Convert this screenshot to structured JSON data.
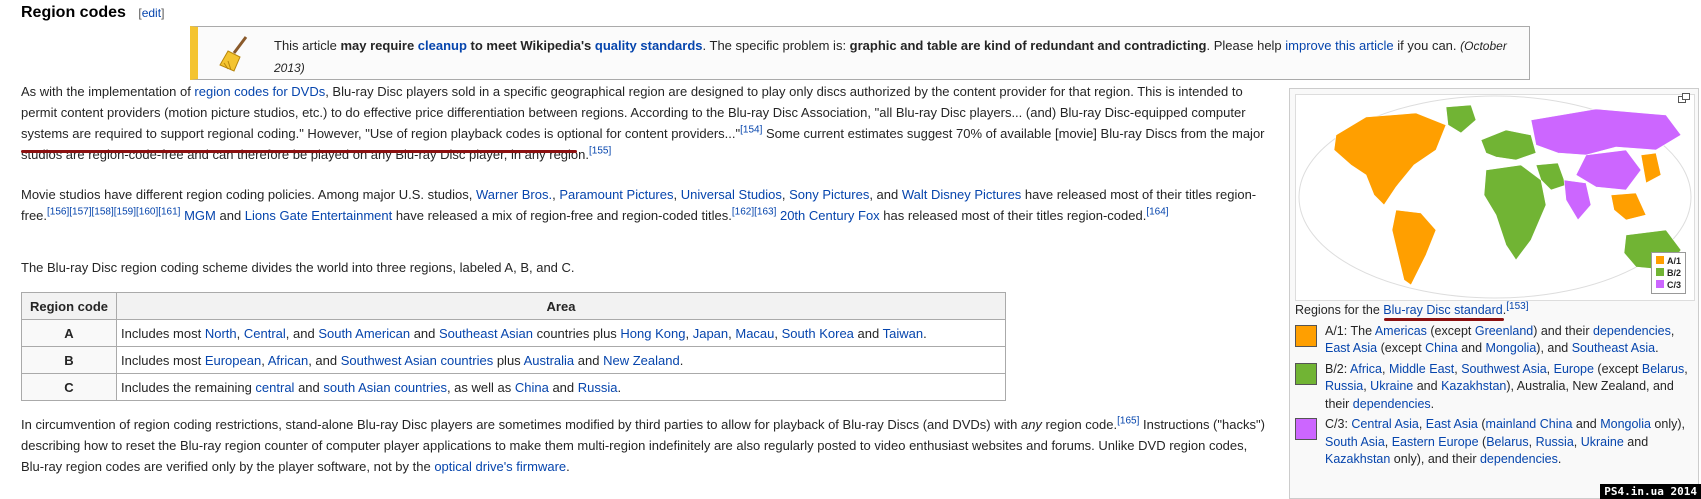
{
  "section": {
    "title": "Region codes",
    "edit_label": "edit"
  },
  "notice": {
    "t1": "This article ",
    "t2": "may require ",
    "cleanup": "cleanup",
    "t3": " to meet Wikipedia's ",
    "quality": "quality standards",
    "t4": ". The specific problem is: ",
    "problem": "graphic and table are kind of redundant and contradicting",
    "t5": ". Please help ",
    "improve": "improve this article",
    "t6": " if you can. ",
    "date": "(October 2013)"
  },
  "p1": {
    "a": "As with the implementation of ",
    "l1": "region codes for DVDs",
    "b": ", Blu-ray Disc players sold in a specific geographical region are designed to play only discs authorized by the content provider for that region. This is intended to permit content providers (motion picture studios, etc.) to do effective price differentiation between regions. According to the Blu-ray Disc Association, \"all Blu-ray Disc players... (and) Blu-ray Disc-equipped computer systems are required to support regional coding.\" However, \"Use of region playback codes is optional for content providers...\"",
    "r1": "[154]",
    "c": " Some current estimates suggest 70% of available [movie] Blu-ray Discs from the major studios are region-code-free and can therefore be played on any Blu-ray Disc player, in any region.",
    "r2": "[155]"
  },
  "p2": {
    "a": "Movie studios have different region coding policies. Among major U.S. studios, ",
    "wb": "Warner Bros.",
    "s1": ", ",
    "pp": "Paramount Pictures",
    "s2": ", ",
    "us": "Universal Studios",
    "s3": ", ",
    "sp": "Sony Pictures",
    "s4": ", and ",
    "wd": "Walt Disney Pictures",
    "b": " have released most of their titles region-free.",
    "r1": "[156][157][158][159][160][161]",
    "mgm": "MGM",
    "c": " and ",
    "lg": "Lions Gate Entertainment",
    "d": " have released a mix of region-free and region-coded titles.",
    "r2": "[162][163]",
    "fox": "20th Century Fox",
    "e": " has released most of their titles region-coded.",
    "r3": "[164]"
  },
  "p3": "The Blu-ray Disc region coding scheme divides the world into three regions, labeled A, B, and C.",
  "table": {
    "h_code": "Region code",
    "h_area": "Area",
    "A": {
      "code": "A",
      "t1": "Includes most ",
      "l1": "North",
      "s1": ", ",
      "l2": "Central",
      "s2": ", and ",
      "l3": "South American",
      "s3": " and ",
      "l4": "Southeast Asian",
      "s4": " countries plus ",
      "l5": "Hong Kong",
      "s5": ", ",
      "l6": "Japan",
      "s6": ", ",
      "l7": "Macau",
      "s7": ", ",
      "l8": "South Korea",
      "s8": " and ",
      "l9": "Taiwan",
      "s9": "."
    },
    "B": {
      "code": "B",
      "t1": "Includes most ",
      "l1": "European",
      "s1": ", ",
      "l2": "African",
      "s2": ", and ",
      "l3": "Southwest Asian countries",
      "s3": " plus ",
      "l4": "Australia",
      "s4": " and ",
      "l5": "New Zealand",
      "s5": "."
    },
    "C": {
      "code": "C",
      "t1": "Includes the remaining ",
      "l1": "central",
      "s1": " and ",
      "l2": "south Asian countries",
      "s2": ", as well as ",
      "l3": "China",
      "s3": " and ",
      "l4": "Russia",
      "s4": "."
    }
  },
  "p4": {
    "a": "In circumvention of region coding restrictions, stand-alone Blu-ray Disc players are sometimes modified by third parties to allow for playback of Blu-ray Discs (and DVDs) with ",
    "any": "any",
    "b": " region code.",
    "r1": "[165]",
    "c": " Instructions (\"hacks\") describing how to reset the Blu-ray region counter of computer player applications to make them multi-region indefinitely are also regularly posted to video enthusiast websites and forums. Unlike DVD region codes, Blu-ray region codes are verified only by the player software, not by the ",
    "l1": "optical drive's firmware",
    "d": "."
  },
  "thumb": {
    "map_legend": [
      "A/1",
      "B/2",
      "C/3"
    ],
    "cap_a": "Regions for the ",
    "cap_link": "Blu-ray Disc standard",
    "cap_b": ".",
    "cap_ref": "[153]",
    "a_label": "A/1: The ",
    "a_l1": "Americas",
    "a_t1": " (except ",
    "a_l2": "Greenland",
    "a_t2": ") and their ",
    "a_l3": "dependencies",
    "a_t3": ", ",
    "a_l4": "East Asia",
    "a_t4": " (except ",
    "a_l5": "China",
    "a_t5": " and ",
    "a_l6": "Mongolia",
    "a_t6": "), and ",
    "a_l7": "Southeast Asia",
    "a_t7": ".",
    "b_label": "B/2: ",
    "b_l1": "Africa",
    "b_t1": ", ",
    "b_l2": "Middle East",
    "b_t2": ", ",
    "b_l3": "Southwest Asia",
    "b_t3": ", ",
    "b_l4": "Europe",
    "b_t4": " (except ",
    "b_l5": "Belarus",
    "b_t5": ", ",
    "b_l6": "Russia",
    "b_t6": ", ",
    "b_l7": "Ukraine",
    "b_t7": " and ",
    "b_l8": "Kazakhstan",
    "b_t8": "), Australia, New Zealand, and their ",
    "b_l9": "dependencies",
    "b_t9": ".",
    "c_label": "C/3: ",
    "c_l1": "Central Asia",
    "c_t1": ", ",
    "c_l2": "East Asia",
    "c_t2": " (",
    "c_l3": "mainland China",
    "c_t3": " and ",
    "c_l4": "Mongolia",
    "c_t4": " only), ",
    "c_l5": "South Asia",
    "c_t5": ", ",
    "c_l6": "Eastern Europe",
    "c_t6": " (",
    "c_l7": "Belarus",
    "c_t7": ", ",
    "c_l8": "Russia",
    "c_t8": ", ",
    "c_l9": "Ukraine",
    "c_t9": " and ",
    "c_l10": "Kazakhstan",
    "c_t10": " only), and their ",
    "c_l11": "dependencies",
    "c_t11": "."
  },
  "colors": {
    "A": "#ff9f00",
    "B": "#71b434",
    "C": "#cc66ff",
    "ocean": "#ffffff",
    "underline": "#8b1010"
  },
  "watermark": "PS4.in.ua  2014"
}
